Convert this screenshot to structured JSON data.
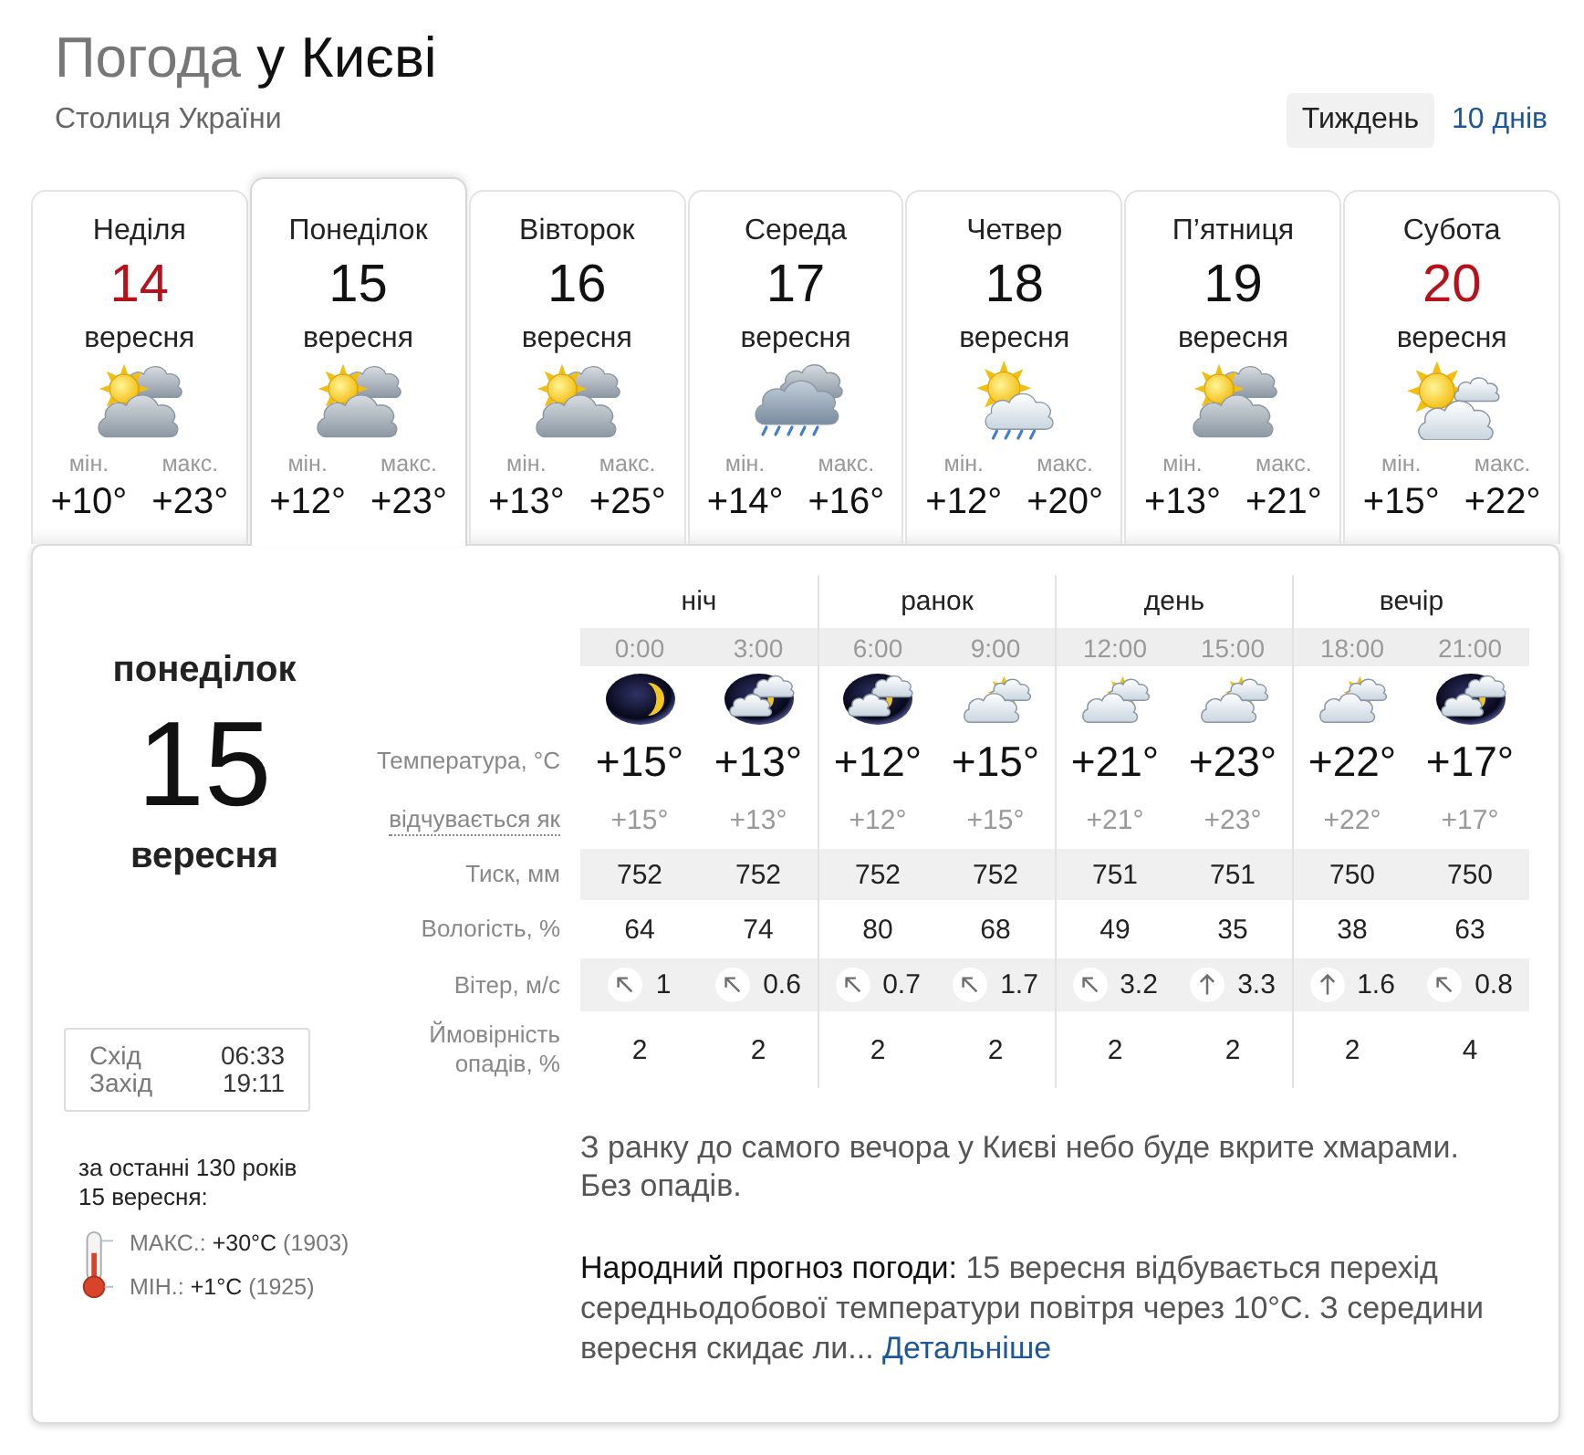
{
  "header": {
    "title_lead": "Погода",
    "title_place": "у Києві",
    "subtitle": "Столиця України",
    "range_tabs": [
      {
        "label": "Тиждень",
        "selected": true
      },
      {
        "label": "10 днів",
        "selected": false
      }
    ]
  },
  "days": [
    {
      "weekday": "Неділя",
      "date": "14",
      "month": "вересня",
      "kind": "sun-clouds",
      "min_label": "мін.",
      "max_label": "макс.",
      "min": "+10°",
      "max": "+23°",
      "weekend": true,
      "selected": false
    },
    {
      "weekday": "Понеділок",
      "date": "15",
      "month": "вересня",
      "kind": "sun-clouds",
      "min_label": "мін.",
      "max_label": "макс.",
      "min": "+12°",
      "max": "+23°",
      "weekend": false,
      "selected": true
    },
    {
      "weekday": "Вівторок",
      "date": "16",
      "month": "вересня",
      "kind": "sun-clouds",
      "min_label": "мін.",
      "max_label": "макс.",
      "min": "+13°",
      "max": "+25°",
      "weekend": false,
      "selected": false
    },
    {
      "weekday": "Середа",
      "date": "17",
      "month": "вересня",
      "kind": "rain",
      "min_label": "мін.",
      "max_label": "макс.",
      "min": "+14°",
      "max": "+16°",
      "weekend": false,
      "selected": false
    },
    {
      "weekday": "Четвер",
      "date": "18",
      "month": "вересня",
      "kind": "sun-cloud-rain",
      "min_label": "мін.",
      "max_label": "макс.",
      "min": "+12°",
      "max": "+20°",
      "weekend": false,
      "selected": false
    },
    {
      "weekday": "П’ятниця",
      "date": "19",
      "month": "вересня",
      "kind": "sun-clouds",
      "min_label": "мін.",
      "max_label": "макс.",
      "min": "+13°",
      "max": "+21°",
      "weekend": false,
      "selected": false
    },
    {
      "weekday": "Субота",
      "date": "20",
      "month": "вересня",
      "kind": "sun-cloud",
      "min_label": "мін.",
      "max_label": "макс.",
      "min": "+15°",
      "max": "+22°",
      "weekend": true,
      "selected": false
    }
  ],
  "detail": {
    "weekday": "понеділок",
    "date": "15",
    "month": "вересня",
    "sun": [
      {
        "label": "Схід",
        "time": "06:33"
      },
      {
        "label": "Захід",
        "time": "19:11"
      }
    ],
    "history": {
      "period": "за останні 130 років",
      "date": "15 вересня:",
      "records": [
        {
          "label": "МАКС.:",
          "value": "+30°C",
          "year": "(1903)"
        },
        {
          "label": "МІН.:",
          "value": "+1°C",
          "year": "(1925)"
        }
      ]
    },
    "row_labels": {
      "temperature": "Температура, °C",
      "feels_like": "відчувається як",
      "pressure": "Тиск, мм",
      "humidity": "Вологість, %",
      "wind": "Вітер, м/с",
      "precipitation": "Ймовірність опадів, %"
    },
    "periods": [
      {
        "name": "ніч",
        "slots": [
          {
            "time": "0:00",
            "kind": "moon",
            "temp": "+15°",
            "feels_like": "+15°",
            "pressure": "752",
            "humidity": "64",
            "wind": {
              "kind": "nw",
              "speed": "1"
            },
            "precipitation": "2"
          },
          {
            "time": "3:00",
            "kind": "moon-cloud",
            "temp": "+13°",
            "feels_like": "+13°",
            "pressure": "752",
            "humidity": "74",
            "wind": {
              "kind": "nw",
              "speed": "0.6"
            },
            "precipitation": "2"
          }
        ]
      },
      {
        "name": "ранок",
        "slots": [
          {
            "time": "6:00",
            "kind": "moon-cloud",
            "temp": "+12°",
            "feels_like": "+12°",
            "pressure": "752",
            "humidity": "80",
            "wind": {
              "kind": "nw",
              "speed": "0.7"
            },
            "precipitation": "2"
          },
          {
            "time": "9:00",
            "kind": "sun-light-clouds",
            "temp": "+15°",
            "feels_like": "+15°",
            "pressure": "752",
            "humidity": "68",
            "wind": {
              "kind": "nw",
              "speed": "1.7"
            },
            "precipitation": "2"
          }
        ]
      },
      {
        "name": "день",
        "slots": [
          {
            "time": "12:00",
            "kind": "sun-light-clouds",
            "temp": "+21°",
            "feels_like": "+21°",
            "pressure": "751",
            "humidity": "49",
            "wind": {
              "kind": "nw",
              "speed": "3.2"
            },
            "precipitation": "2"
          },
          {
            "time": "15:00",
            "kind": "sun-light-clouds",
            "temp": "+23°",
            "feels_like": "+23°",
            "pressure": "751",
            "humidity": "35",
            "wind": {
              "kind": "n",
              "speed": "3.3"
            },
            "precipitation": "2"
          }
        ]
      },
      {
        "name": "вечір",
        "slots": [
          {
            "time": "18:00",
            "kind": "sun-light-clouds",
            "temp": "+22°",
            "feels_like": "+22°",
            "pressure": "750",
            "humidity": "38",
            "wind": {
              "kind": "n",
              "speed": "1.6"
            },
            "precipitation": "2"
          },
          {
            "time": "21:00",
            "kind": "moon-cloud",
            "temp": "+17°",
            "feels_like": "+17°",
            "pressure": "750",
            "humidity": "63",
            "wind": {
              "kind": "nw",
              "speed": "0.8"
            },
            "precipitation": "4"
          }
        ]
      }
    ],
    "summary": "З ранку до самого вечора у Києві небо буде вкрите хмарами. Без опадів.",
    "folk": {
      "label": "Народний прогноз погоди:",
      "text": "15 вересня відбувається перехід середньодобової температури повітря через 10°C. З середини вересня скидає ли...",
      "link": "Детальніше"
    }
  }
}
